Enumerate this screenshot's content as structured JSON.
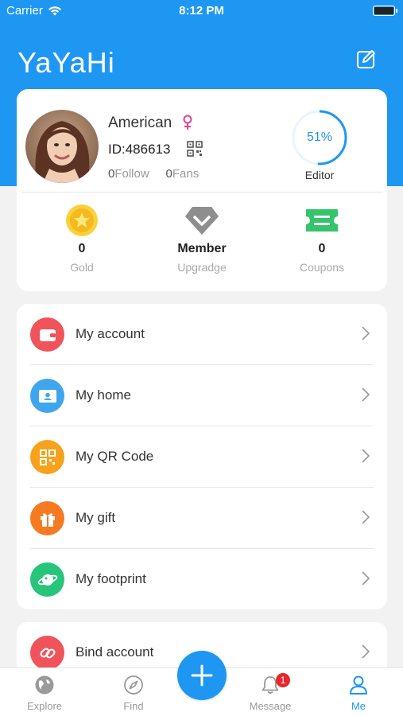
{
  "status_bar": {
    "carrier": "Carrier",
    "time": "8:12 PM"
  },
  "header": {
    "title": "YaYaHi"
  },
  "profile": {
    "name": "American",
    "id_text": "ID:486613",
    "follow_count": "0",
    "follow_label": "Follow",
    "fans_count": "0",
    "fans_label": "Fans",
    "progress_text": "51%",
    "progress_value": 0.51,
    "role": "Editor"
  },
  "stats": [
    {
      "value": "0",
      "label": "Gold",
      "icon": "gold-coin-icon"
    },
    {
      "value": "Member",
      "label": "Upgradge",
      "icon": "diamond-icon"
    },
    {
      "value": "0",
      "label": "Coupons",
      "icon": "ticket-icon"
    }
  ],
  "menu": [
    {
      "label": "My account",
      "icon": "wallet-icon",
      "color": "#f0545a"
    },
    {
      "label": "My home",
      "icon": "home-card-icon",
      "color": "#3fa6ee"
    },
    {
      "label": "My QR Code",
      "icon": "qr-code-icon",
      "color": "#f7a21c"
    },
    {
      "label": "My gift",
      "icon": "gift-icon",
      "color": "#f57a22"
    },
    {
      "label": "My footprint",
      "icon": "planet-icon",
      "color": "#26c57a"
    }
  ],
  "bind": {
    "label": "Bind account",
    "icon": "link-icon",
    "color": "#f0545a"
  },
  "tabs": [
    {
      "label": "Explore",
      "icon": "globe-icon"
    },
    {
      "label": "Find",
      "icon": "compass-icon"
    },
    {
      "label": "Message",
      "icon": "bell-icon",
      "badge": "1"
    },
    {
      "label": "Me",
      "icon": "user-icon"
    }
  ],
  "colors": {
    "primary": "#1e97f3",
    "badge": "#e8262b"
  }
}
